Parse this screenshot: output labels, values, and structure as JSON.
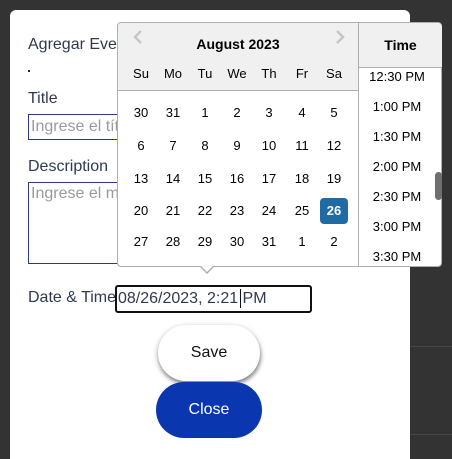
{
  "modal": {
    "title": "Agregar Eve",
    "title_label": "Title",
    "title_placeholder": "Ingrese el tít",
    "description_label": "Description",
    "description_placeholder": "Ingrese el m",
    "datetime_label": "Date & Time",
    "datetime_value": "08/26/2023, 2:21 PM",
    "save_label": "Save",
    "close_label": "Close"
  },
  "datepicker": {
    "month_title": "August 2023",
    "prev_icon": "chevron-left-icon",
    "next_icon": "chevron-right-icon",
    "weekdays": [
      "Su",
      "Mo",
      "Tu",
      "We",
      "Th",
      "Fr",
      "Sa"
    ],
    "weeks": [
      [
        "30",
        "31",
        "1",
        "2",
        "3",
        "4",
        "5"
      ],
      [
        "6",
        "7",
        "8",
        "9",
        "10",
        "11",
        "12"
      ],
      [
        "13",
        "14",
        "15",
        "16",
        "17",
        "18",
        "19"
      ],
      [
        "20",
        "21",
        "22",
        "23",
        "24",
        "25",
        "26"
      ],
      [
        "27",
        "28",
        "29",
        "30",
        "31",
        "1",
        "2"
      ]
    ],
    "selected_day": "26",
    "selected_color": "#216ba5",
    "time_header": "Time",
    "times": [
      "12:30 PM",
      "1:00 PM",
      "1:30 PM",
      "2:00 PM",
      "2:30 PM",
      "3:00 PM",
      "3:30 PM"
    ]
  },
  "colors": {
    "close_button": "#0a36b0",
    "input_border": "#2b3a8f",
    "backdrop": "#333333"
  }
}
